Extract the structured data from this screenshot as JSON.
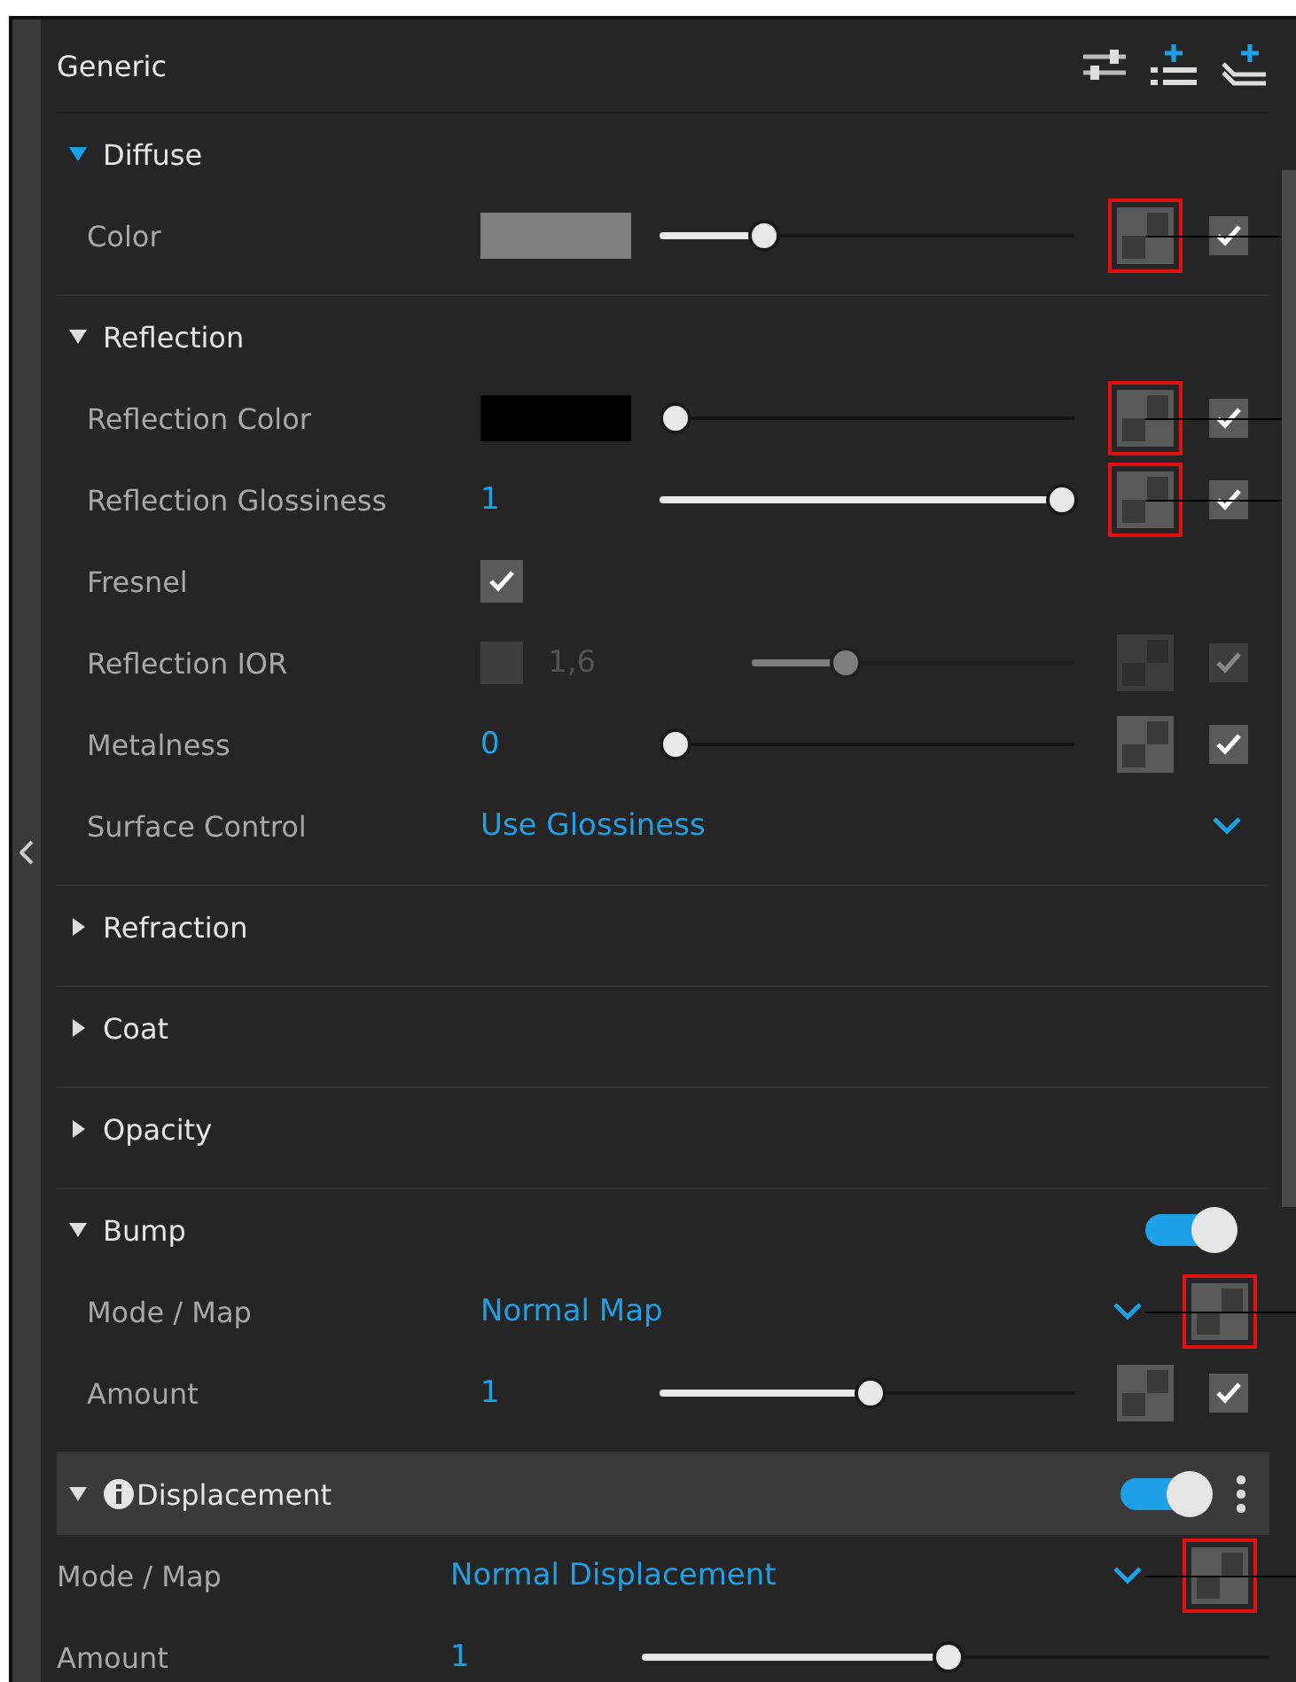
{
  "header": {
    "title": "Generic"
  },
  "sections": [
    {
      "title": "Diffuse",
      "expanded": true,
      "focused": true,
      "selected": false,
      "rows": [
        {
          "kind": "color",
          "label": "Color",
          "color": "#808080",
          "level": 0.25,
          "map": true,
          "annotated": true,
          "override": true
        }
      ]
    },
    {
      "title": "Reflection",
      "expanded": true,
      "focused": false,
      "selected": false,
      "rows": [
        {
          "kind": "color",
          "label": "Reflection Color",
          "color": "#000000",
          "level": 0.04,
          "map": true,
          "annotated": true,
          "override": true
        },
        {
          "kind": "number",
          "label": "Reflection Glossiness",
          "value": "1",
          "level": 0.97,
          "map": true,
          "annotated": true,
          "override": true
        },
        {
          "kind": "checkbox",
          "label": "Fresnel",
          "checked": true
        },
        {
          "kind": "toggled-number",
          "label": "Reflection IOR",
          "checked": false,
          "value": "1,6",
          "level": 0.29,
          "disabled": true,
          "map": true,
          "annotated": false,
          "override": true
        },
        {
          "kind": "number",
          "label": "Metalness",
          "value": "0",
          "level": 0.04,
          "map": true,
          "annotated": false,
          "override": true
        },
        {
          "kind": "dropdown",
          "label": "Surface Control",
          "value": "Use Glossiness"
        }
      ]
    },
    {
      "title": "Refraction",
      "expanded": false,
      "focused": false,
      "selected": false
    },
    {
      "title": "Coat",
      "expanded": false,
      "focused": false,
      "selected": false
    },
    {
      "title": "Opacity",
      "expanded": false,
      "focused": false,
      "selected": false
    },
    {
      "title": "Bump",
      "expanded": true,
      "focused": false,
      "selected": false,
      "enabled": true,
      "rows": [
        {
          "kind": "dropdown",
          "label": "Mode / Map",
          "value": "Normal Map",
          "map": true,
          "annotated": true
        },
        {
          "kind": "number",
          "label": "Amount",
          "value": "1",
          "level": 0.51,
          "map": true,
          "annotated": false,
          "override": true
        }
      ]
    },
    {
      "title": "Displacement",
      "expanded": true,
      "focused": false,
      "selected": true,
      "enabled": true,
      "info": true,
      "menu": true,
      "rows": [
        {
          "kind": "dropdown",
          "label": "Mode / Map",
          "value": "Normal Displacement",
          "map": true,
          "annotated": true
        },
        {
          "kind": "number",
          "label": "Amount",
          "value": "1",
          "level": 0.49
        }
      ]
    }
  ]
}
